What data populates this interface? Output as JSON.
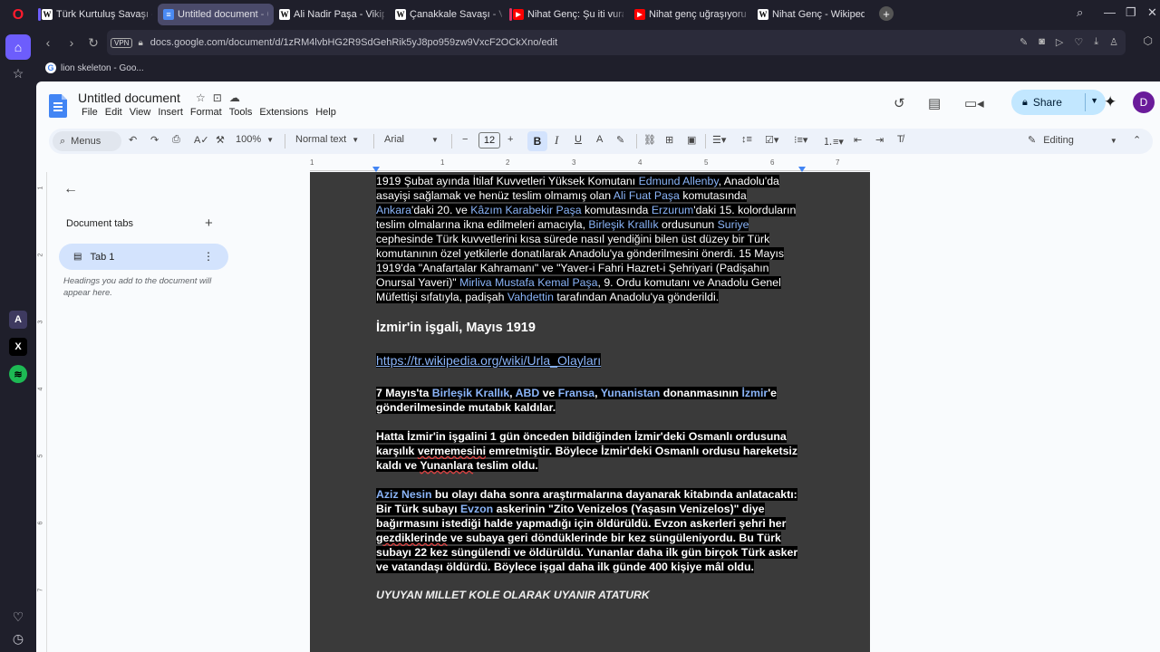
{
  "browser": {
    "tabs": [
      {
        "label": "Türk Kurtuluş Savaşı - Vik",
        "icon": "wikipedia-icon",
        "active": false
      },
      {
        "label": "Untitled document - Goo",
        "icon": "docs-icon",
        "active": true
      },
      {
        "label": "Ali Nadir Paşa - Vikipedi",
        "icon": "wikipedia-icon",
        "active": false
      },
      {
        "label": "Çanakkale Savaşı - Vikipe",
        "icon": "wikipedia-icon",
        "active": false
      },
      {
        "label": "Nihat Genç: Şu iti vuracak",
        "icon": "youtube-icon",
        "active": false
      },
      {
        "label": "Nihat genç uğraşıyoruz -",
        "icon": "youtube-icon",
        "active": false
      },
      {
        "label": "Nihat Genç - Wikipedia",
        "icon": "wikipedia-icon",
        "active": false
      }
    ],
    "url": "docs.google.com/document/d/1zRM4lvbHG2R9SdGehRik5yJ8po959zw9VxcF2OCkXno/edit",
    "vpn_label": "VPN",
    "bookmark": "lion skeleton - Goo..."
  },
  "docs": {
    "title": "Untitled document",
    "menu": [
      "File",
      "Edit",
      "View",
      "Insert",
      "Format",
      "Tools",
      "Extensions",
      "Help"
    ],
    "share_label": "Share",
    "avatar_letter": "D",
    "toolbar": {
      "menus_label": "Menus",
      "zoom": "100%",
      "style": "Normal text",
      "font": "Arial",
      "font_size": "12",
      "mode": "Editing"
    },
    "ruler": [
      "1",
      "1",
      "2",
      "3",
      "4",
      "5",
      "6",
      "7"
    ],
    "v_ruler": [
      "1",
      "2",
      "3",
      "4",
      "5",
      "6",
      "7"
    ],
    "sidebar": {
      "doc_tabs_label": "Document tabs",
      "tab1": "Tab 1",
      "hint": "Headings you add to the document will appear here."
    }
  }
}
